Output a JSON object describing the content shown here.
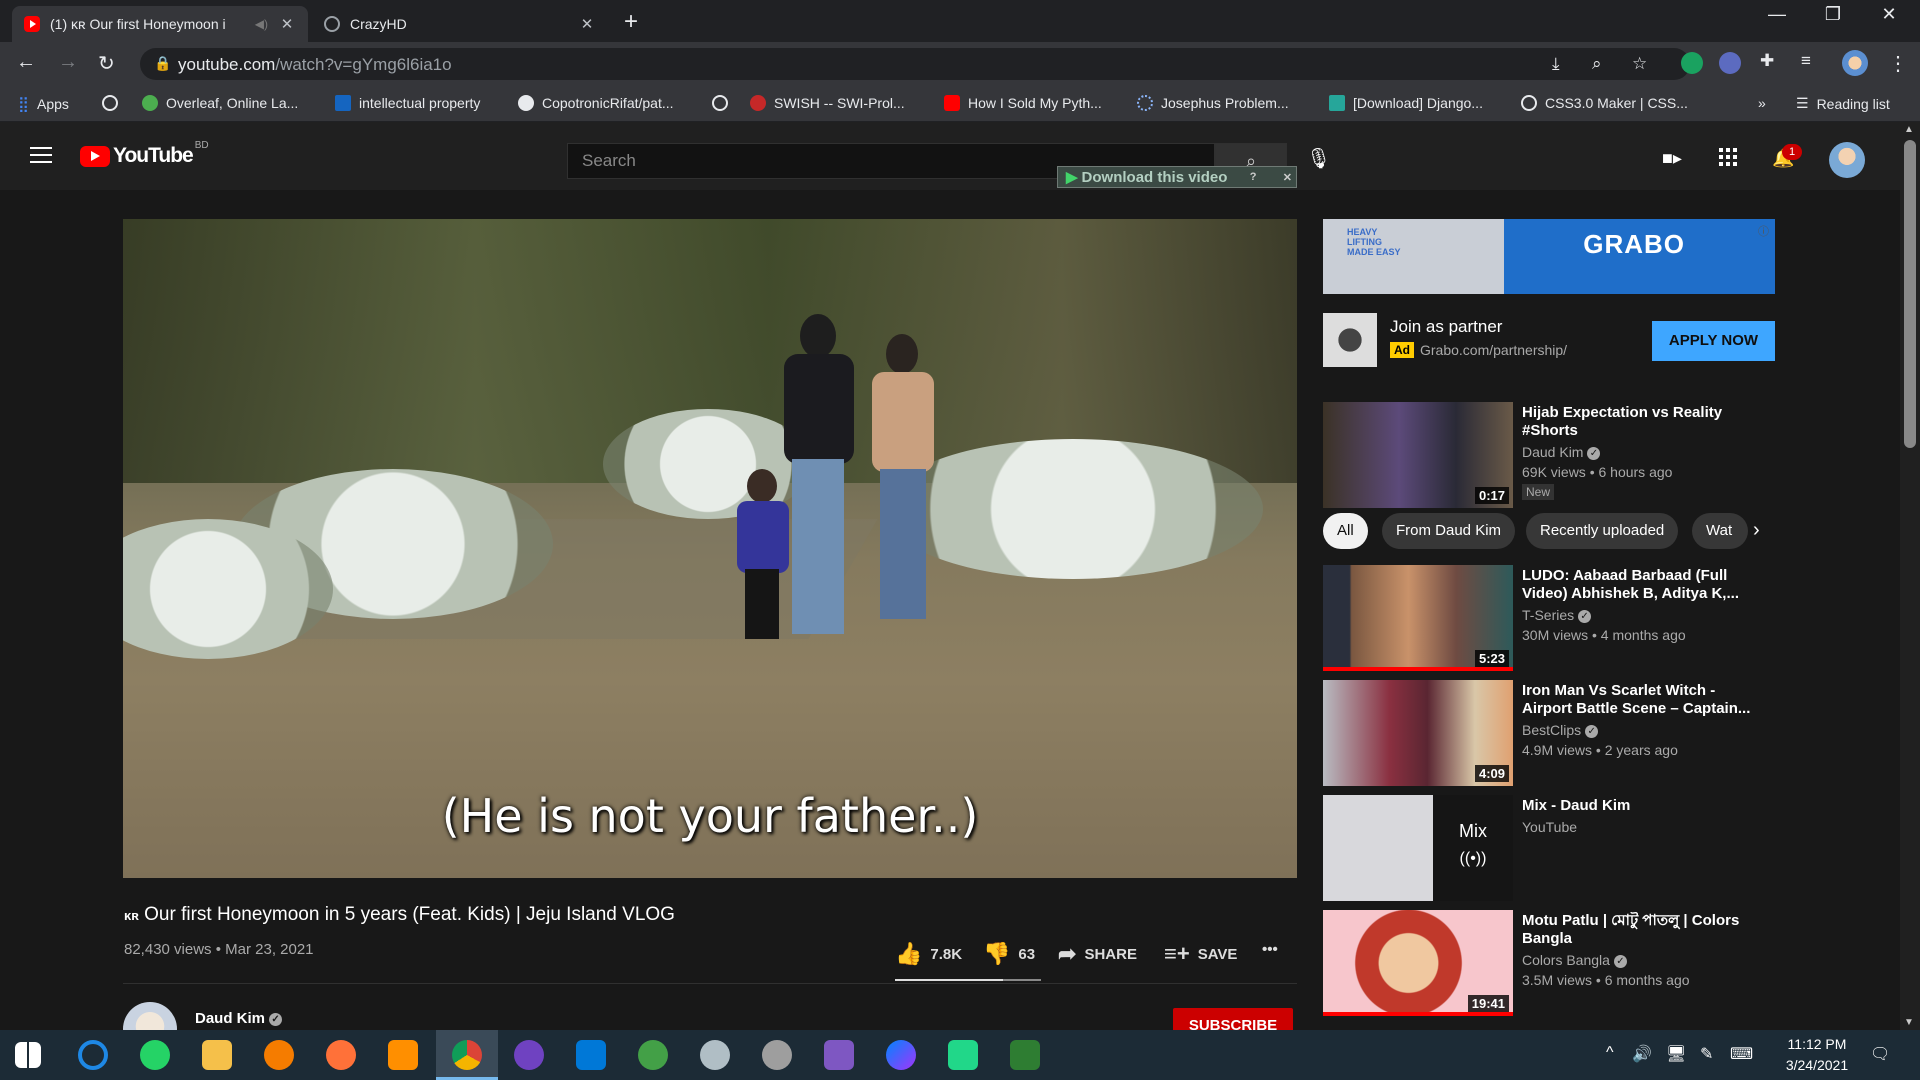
{
  "browser": {
    "tabs": [
      {
        "title": "(1) ᴋʀ Our first Honeymoon i",
        "active": true
      },
      {
        "title": "CrazyHD",
        "active": false
      }
    ],
    "url_host": "youtube.com",
    "url_path": "/watch?v=gYmg6l6ia1o",
    "bookmarks": [
      "Apps",
      "",
      "Overleaf, Online La...",
      "intellectual property",
      "CopotronicRifat/pat...",
      "",
      "SWISH -- SWI-Prol...",
      "How I Sold My Pyth...",
      "Josephus Problem...",
      "[Download] Django...",
      "CSS3.0 Maker | CSS..."
    ],
    "bookmarks_more": "»",
    "reading_list": "Reading list"
  },
  "youtube": {
    "logo_text": "YouTube",
    "country_code": "BD",
    "search_placeholder": "Search",
    "download_bar": "Download this video",
    "notification_count": "1"
  },
  "video": {
    "subtitle": "(He is not your father..)",
    "title_prefix": "ᴋʀ",
    "title": "Our first Honeymoon in 5 years (Feat. Kids) | Jeju Island VLOG",
    "meta": "82,430 views • Mar 23, 2021",
    "likes": "7.8K",
    "dislikes": "63",
    "like_ratio": 0.74,
    "share": "SHARE",
    "save": "SAVE",
    "more": "•••",
    "channel": "Daud Kim",
    "subscribe": "SUBSCRIBE"
  },
  "ad": {
    "banner_brand": "GRABO",
    "banner_slogan": "HEAVY LIFTING MADE EASY",
    "title": "Join as partner",
    "badge": "Ad",
    "domain": "Grabo.com/partnership/",
    "cta": "APPLY NOW"
  },
  "chips": [
    "All",
    "From Daud Kim",
    "Recently uploaded",
    "Wat"
  ],
  "recommendations": [
    {
      "title": "Hijab Expectation vs Reality #Shorts",
      "channel": "Daud Kim",
      "meta": "69K views • 6 hours ago",
      "badge": "New",
      "duration": "0:17"
    },
    {
      "title": "LUDO: Aabaad Barbaad (Full Video) Abhishek B, Aditya K,...",
      "channel": "T-Series",
      "meta": "30M views • 4 months ago",
      "duration": "5:23"
    },
    {
      "title": "Iron Man Vs Scarlet Witch - Airport Battle Scene – Captain...",
      "channel": "BestClips",
      "meta": "4.9M views • 2 years ago",
      "duration": "4:09"
    },
    {
      "title": "Mix - Daud Kim",
      "channel": "YouTube",
      "meta": "",
      "duration": "Mix"
    },
    {
      "title": "Motu Patlu | মোটু পাতলু | Colors Bangla",
      "channel": "Colors Bangla",
      "meta": "3.5M views • 6 months ago",
      "duration": "19:41"
    }
  ],
  "taskbar": {
    "time": "11:12 PM",
    "date": "3/24/2021"
  }
}
